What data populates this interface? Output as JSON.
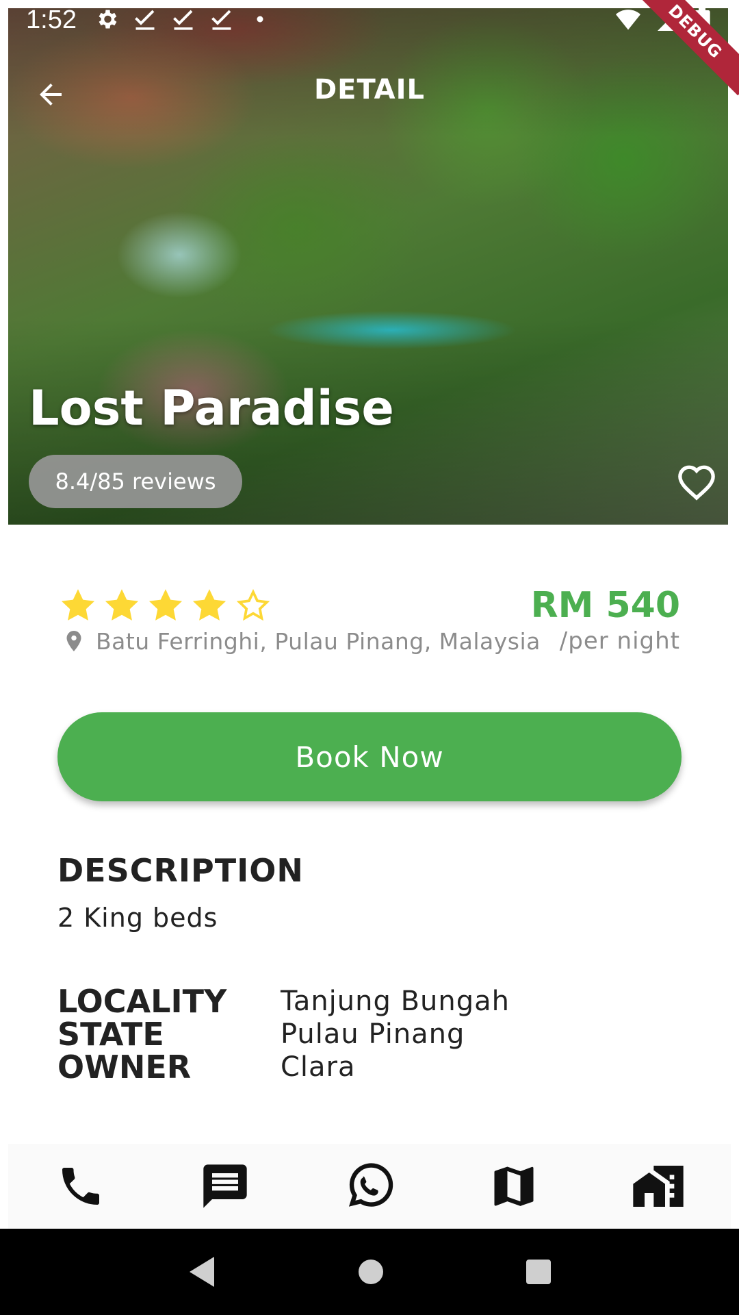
{
  "status_bar": {
    "time": "1:52",
    "debug_label": "DEBUG"
  },
  "app_bar": {
    "title": "DETAIL",
    "back_icon": "arrow-back-icon"
  },
  "hero": {
    "hotel_name": "Lost Paradise",
    "reviews": "8.4/85 reviews",
    "favorite_icon": "heart-outline-icon"
  },
  "rating": {
    "stars": 4,
    "max_stars": 5,
    "color": "#fdd835"
  },
  "location": "Batu Ferringhi, Pulau Pinang, Malaysia",
  "price": {
    "amount": "RM 540",
    "unit": "/per night",
    "color": "#4caf50"
  },
  "book_button": {
    "label": "Book Now",
    "color": "#4caf50"
  },
  "description": {
    "heading": "DESCRIPTION",
    "text": "2 King beds"
  },
  "details": [
    {
      "label": "LOCALITY",
      "value": "Tanjung Bungah"
    },
    {
      "label": "STATE",
      "value": "Pulau Pinang"
    },
    {
      "label": "OWNER",
      "value": "Clara"
    }
  ],
  "bottom_nav": [
    "phone-icon",
    "message-icon",
    "whatsapp-icon",
    "map-icon",
    "home-work-icon"
  ]
}
